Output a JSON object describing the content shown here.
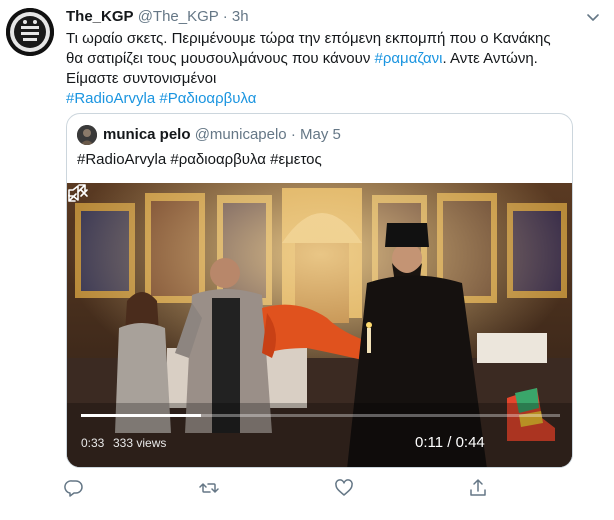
{
  "tweet": {
    "author_name": "The_KGP",
    "author_handle": "@The_KGP",
    "separator": "·",
    "time": "3h",
    "text_line_1": "Τι ωραίο σκετς. Περιμένουμε τώρα την επόμενη εκπομπή που ο Κανάκης",
    "text_line_2_a": "θα σατιρίζει τους μουσουλμάνους που κάνουν ",
    "text_line_2_hashtag": "#ραμαζανι",
    "text_line_2_b": ". Αντε Αντώνη.",
    "text_line_3": "Είμαστε συντονισμένοι",
    "hashtag_1": "#RadioArvyla",
    "hashtag_2": "#Ραδιοαρβυλα"
  },
  "quoted_tweet": {
    "author_name": "munica pelo",
    "author_handle": "@municapelo",
    "separator": "·",
    "time": "May 5",
    "text": "#RadioArvyla #ραδιοαρβυλα #εμετος"
  },
  "video": {
    "elapsed_left": "0:33",
    "views": "333 views",
    "time": "0:11 / 0:44",
    "progress_fraction": 0.25
  },
  "icons": {
    "more": "chevron-down-icon",
    "reply": "reply-icon",
    "retweet": "retweet-icon",
    "like": "like-icon",
    "share": "share-icon",
    "mute": "volume-muted-icon",
    "fullscreen": "fullscreen-icon"
  },
  "colors": {
    "link": "#1b95e0",
    "secondary_text": "#657786",
    "border": "#ccd6dd",
    "action_icon": "#657786"
  }
}
